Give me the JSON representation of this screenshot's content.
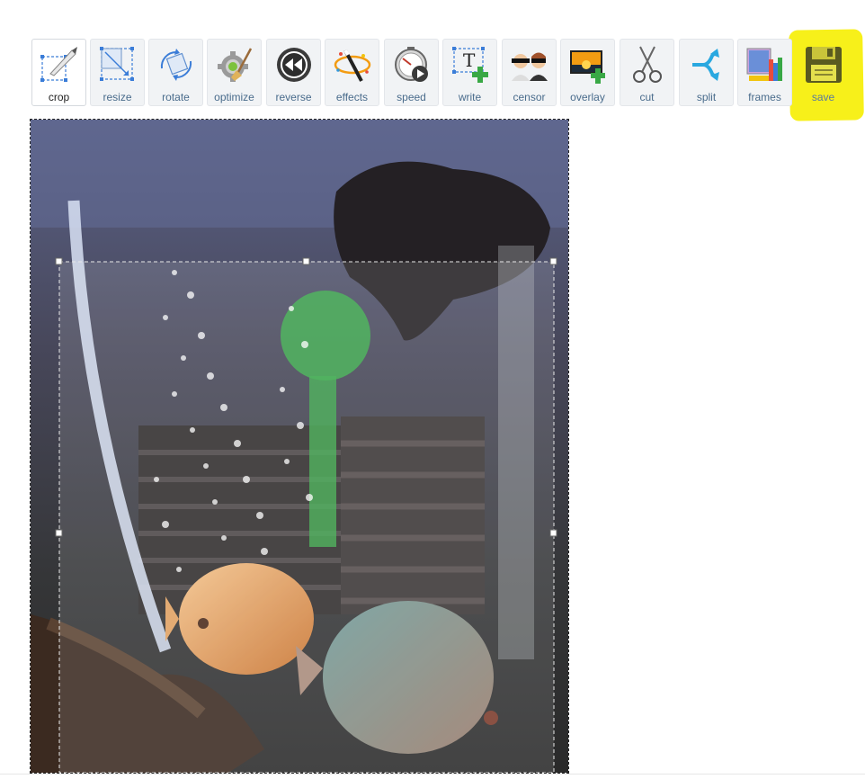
{
  "toolbar": {
    "tools": [
      {
        "label": "crop",
        "icon": "crop-icon",
        "active": true
      },
      {
        "label": "resize",
        "icon": "resize-icon"
      },
      {
        "label": "rotate",
        "icon": "rotate-icon"
      },
      {
        "label": "optimize",
        "icon": "optimize-icon"
      },
      {
        "label": "reverse",
        "icon": "reverse-icon"
      },
      {
        "label": "effects",
        "icon": "effects-icon"
      },
      {
        "label": "speed",
        "icon": "speed-icon"
      },
      {
        "label": "write",
        "icon": "write-icon"
      },
      {
        "label": "censor",
        "icon": "censor-icon"
      },
      {
        "label": "overlay",
        "icon": "overlay-icon"
      },
      {
        "label": "cut",
        "icon": "cut-icon"
      },
      {
        "label": "split",
        "icon": "split-icon"
      },
      {
        "label": "frames",
        "icon": "frames-icon"
      },
      {
        "label": "save",
        "icon": "save-icon",
        "highlighted": true
      }
    ]
  },
  "colors": {
    "highlight": "#f7f01a",
    "label": "#4a6c8c",
    "tool_bg": "#f1f3f5"
  }
}
